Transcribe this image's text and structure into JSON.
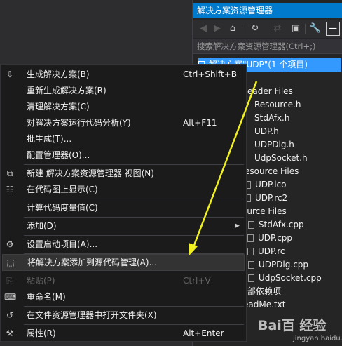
{
  "solution_explorer": {
    "title": "解决方案资源管理器",
    "search_placeholder": "搜索解决方案资源管理器(Ctrl+;)",
    "toolbar": {
      "back_icon": "◀",
      "forward_icon": "▶",
      "home_icon": "⌂",
      "history_icon": "↻",
      "sync_icon": "⇄",
      "collapse_icon": "▣",
      "properties_icon": "🔧",
      "pin_icon": "—"
    },
    "tree": [
      {
        "label": "解决方案\"UDP\"(1 个项目)"
      },
      {
        "label": "eader Files"
      },
      {
        "label": "Resource.h"
      },
      {
        "label": "StdAfx.h"
      },
      {
        "label": "UDP.h"
      },
      {
        "label": "UDPDlg.h"
      },
      {
        "label": "UdpSocket.h"
      },
      {
        "label": "esource Files"
      },
      {
        "label": "UDP.ico"
      },
      {
        "label": "UDP.rc2"
      },
      {
        "label": "ource Files"
      },
      {
        "label": "StdAfx.cpp"
      },
      {
        "label": "UDP.cpp"
      },
      {
        "label": "UDP.rc"
      },
      {
        "label": "UDPDlg.cpp"
      },
      {
        "label": "UdpSocket.cpp"
      },
      {
        "label": "部依赖项"
      },
      {
        "label": "eadMe.txt"
      }
    ]
  },
  "context_menu": {
    "items": [
      {
        "label": "生成解决方案(B)",
        "shortcut": "Ctrl+Shift+B",
        "icon": "⇩"
      },
      {
        "label": "重新生成解决方案(R)",
        "shortcut": "",
        "icon": ""
      },
      {
        "label": "清理解决方案(C)",
        "shortcut": "",
        "icon": ""
      },
      {
        "label": "对解决方案运行代码分析(Y)",
        "shortcut": "Alt+F11",
        "icon": ""
      },
      {
        "label": "批生成(T)...",
        "shortcut": "",
        "icon": ""
      },
      {
        "label": "配置管理器(O)...",
        "shortcut": "",
        "icon": ""
      },
      {
        "label": "新建 解决方案资源管理器 视图(N)",
        "shortcut": "",
        "icon": "⧉"
      },
      {
        "label": "在代码图上显示(C)",
        "shortcut": "",
        "icon": "☷"
      },
      {
        "label": "计算代码度量值(C)",
        "shortcut": "",
        "icon": ""
      },
      {
        "label": "添加(D)",
        "shortcut": "",
        "icon": "",
        "submenu": "▶"
      },
      {
        "label": "设置启动项目(A)...",
        "shortcut": "",
        "icon": "⚙"
      },
      {
        "label": "将解决方案添加到源代码管理(A)...",
        "shortcut": "",
        "icon": "⬚"
      },
      {
        "label": "粘贴(P)",
        "shortcut": "Ctrl+V",
        "icon": "⎘"
      },
      {
        "label": "重命名(M)",
        "shortcut": "",
        "icon": "⌨"
      },
      {
        "label": "在文件资源管理器中打开文件夹(X)",
        "shortcut": "",
        "icon": "↺"
      },
      {
        "label": "属性(R)",
        "shortcut": "Alt+Enter",
        "icon": "⚒"
      }
    ]
  },
  "watermark": {
    "main": "Bai百 经验",
    "sub": "jingyan.baidu.com"
  },
  "colors": {
    "accent": "#007acc",
    "selection": "#3399ff",
    "annotation_arrow": "#f0f020"
  }
}
